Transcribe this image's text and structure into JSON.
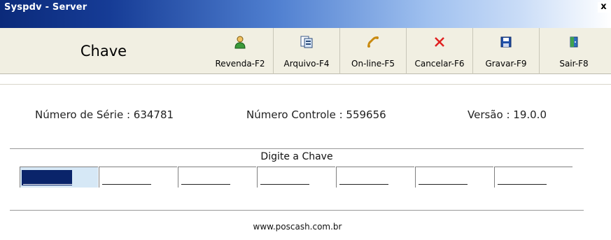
{
  "window": {
    "title": "Syspdv - Server",
    "close_symbol": "x"
  },
  "header": {
    "title": "Chave"
  },
  "toolbar": [
    {
      "label": "Revenda-F2",
      "icon": "person-icon"
    },
    {
      "label": "Arquivo-F4",
      "icon": "file-icon"
    },
    {
      "label": "On-line-F5",
      "icon": "phone-icon"
    },
    {
      "label": "Cancelar-F6",
      "icon": "cancel-icon"
    },
    {
      "label": "Gravar-F9",
      "icon": "save-icon"
    },
    {
      "label": "Sair-F8",
      "icon": "exit-icon"
    }
  ],
  "info": {
    "serial_label": "Número de Série :",
    "serial_value": "634781",
    "controle_label": "Número Controle :",
    "controle_value": "559656",
    "versao_label": "Versão :",
    "versao_value": "19.0.0"
  },
  "key_entry": {
    "label": "Digite a Chave",
    "fields": [
      "",
      "",
      "",
      "",
      "",
      "",
      ""
    ]
  },
  "footer": {
    "website": "www.poscash.com.br"
  },
  "colors": {
    "title_bar_start": "#0b2a7a",
    "selection": "#0a246a",
    "toolbar_bg": "#f1efe2"
  }
}
